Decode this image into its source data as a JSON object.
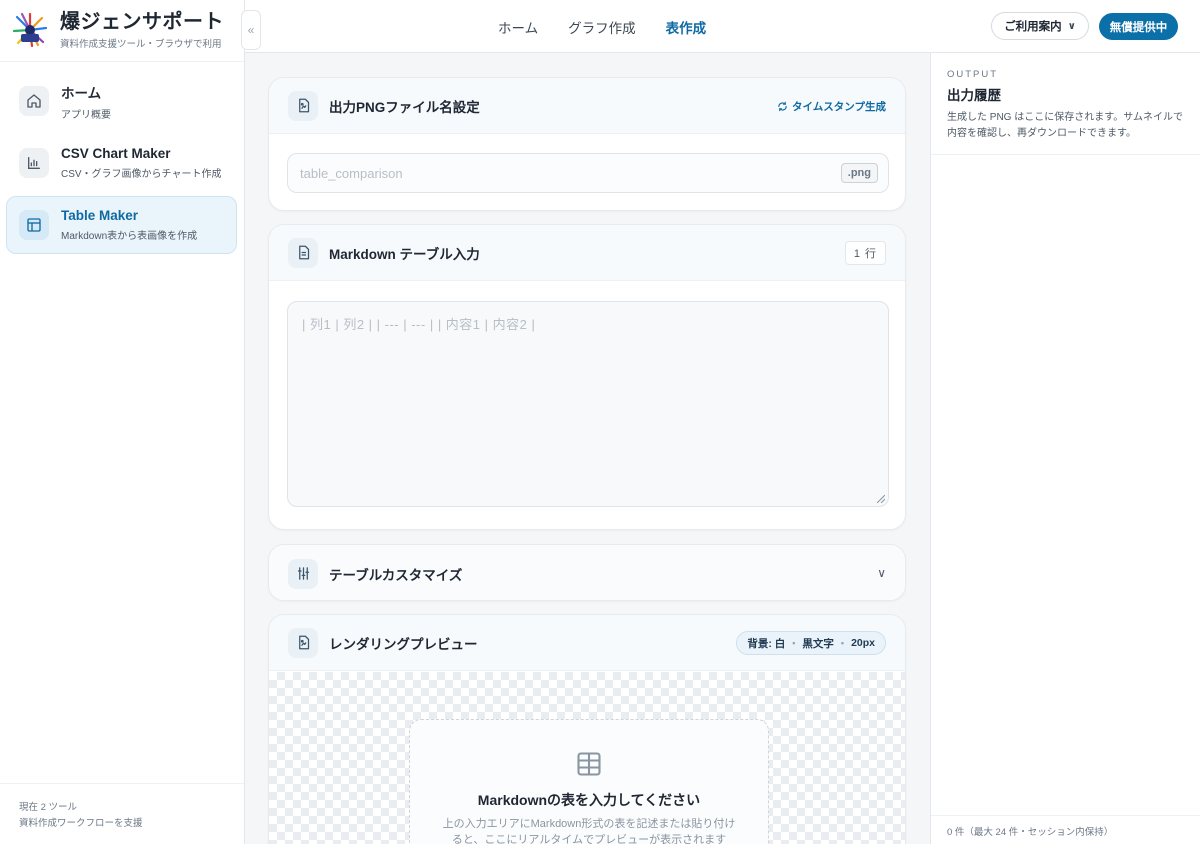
{
  "brand": {
    "title": "爆ジェンサポート",
    "subtitle": "資料作成支援ツール・ブラウザで利用",
    "collapse_icon": "«"
  },
  "sidebar": {
    "items": [
      {
        "title": "ホーム",
        "desc": "アプリ概要",
        "icon": "home-icon"
      },
      {
        "title": "CSV Chart Maker",
        "desc": "CSV・グラフ画像からチャート作成",
        "icon": "bar-chart-icon"
      },
      {
        "title": "Table Maker",
        "desc": "Markdown表から表画像を作成",
        "icon": "table-icon"
      }
    ],
    "footer": {
      "line1": "現在 2 ツール",
      "line2": "資料作成ワークフローを支援"
    }
  },
  "topbar": {
    "nav": [
      "ホーム",
      "グラフ作成",
      "表作成"
    ],
    "active_nav": "表作成",
    "guide_label": "ご利用案内",
    "guide_chevron": "∨",
    "free_label": "無償提供中"
  },
  "filename_card": {
    "title": "出力PNGファイル名設定",
    "timestamp_label": "タイムスタンプ生成",
    "placeholder": "table_comparison",
    "extension": ".png"
  },
  "markdown_card": {
    "title": "Markdown テーブル入力",
    "rows_badge": "1 行",
    "placeholder": "| 列1 | 列2 | | --- | --- | | 内容1 | 内容2 |"
  },
  "customize_card": {
    "title": "テーブルカスタマイズ",
    "chevron": "∨"
  },
  "preview_card": {
    "title": "レンダリングプレビュー",
    "pill": {
      "background": "背景: 白",
      "text": "黒文字",
      "size": "20px",
      "separator": "•"
    },
    "empty_title": "Markdownの表を入力してください",
    "empty_desc": "上の入力エリアにMarkdown形式の表を記述または貼り付けると、ここにリアルタイムでプレビューが表示されます"
  },
  "output_panel": {
    "eyebrow": "OUTPUT",
    "title": "出力履歴",
    "desc": "生成した PNG はここに保存されます。サムネイルで内容を確認し、再ダウンロードできます。",
    "footer": "0 件（最大 24 件・セッション内保持）"
  },
  "colors": {
    "accent": "#0b6fa8",
    "active_text": "#0f6aa3",
    "active_bg": "#eaf4fb"
  }
}
